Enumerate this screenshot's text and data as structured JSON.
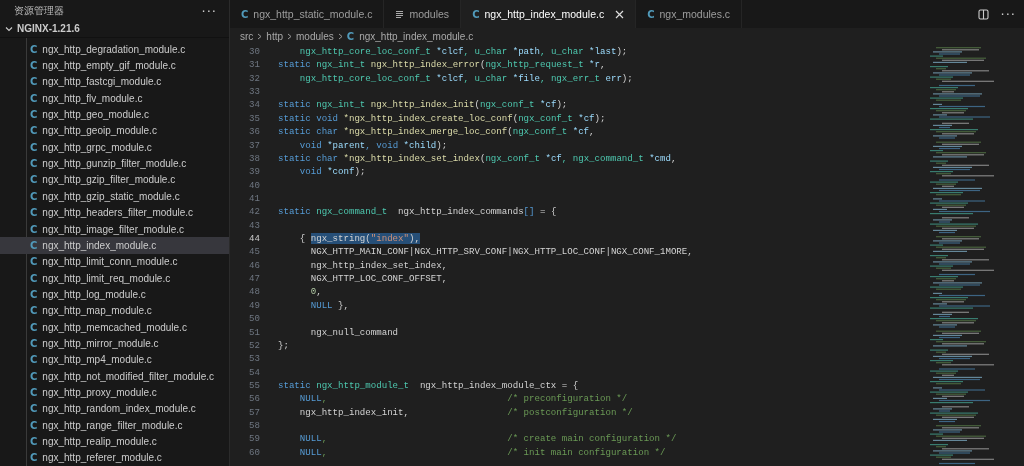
{
  "explorer": {
    "title": "资源管理器",
    "more": "···",
    "folder": {
      "name": "NGINX-1.21.6",
      "expanded": true,
      "children": [
        {
          "name": "ngx_http_degradation_module.c",
          "icon": "C",
          "selected": false
        },
        {
          "name": "ngx_http_empty_gif_module.c",
          "icon": "C",
          "selected": false
        },
        {
          "name": "ngx_http_fastcgi_module.c",
          "icon": "C",
          "selected": false
        },
        {
          "name": "ngx_http_flv_module.c",
          "icon": "C",
          "selected": false
        },
        {
          "name": "ngx_http_geo_module.c",
          "icon": "C",
          "selected": false
        },
        {
          "name": "ngx_http_geoip_module.c",
          "icon": "C",
          "selected": false
        },
        {
          "name": "ngx_http_grpc_module.c",
          "icon": "C",
          "selected": false
        },
        {
          "name": "ngx_http_gunzip_filter_module.c",
          "icon": "C",
          "selected": false
        },
        {
          "name": "ngx_http_gzip_filter_module.c",
          "icon": "C",
          "selected": false
        },
        {
          "name": "ngx_http_gzip_static_module.c",
          "icon": "C",
          "selected": false
        },
        {
          "name": "ngx_http_headers_filter_module.c",
          "icon": "C",
          "selected": false
        },
        {
          "name": "ngx_http_image_filter_module.c",
          "icon": "C",
          "selected": false
        },
        {
          "name": "ngx_http_index_module.c",
          "icon": "C",
          "selected": true
        },
        {
          "name": "ngx_http_limit_conn_module.c",
          "icon": "C",
          "selected": false
        },
        {
          "name": "ngx_http_limit_req_module.c",
          "icon": "C",
          "selected": false
        },
        {
          "name": "ngx_http_log_module.c",
          "icon": "C",
          "selected": false
        },
        {
          "name": "ngx_http_map_module.c",
          "icon": "C",
          "selected": false
        },
        {
          "name": "ngx_http_memcached_module.c",
          "icon": "C",
          "selected": false
        },
        {
          "name": "ngx_http_mirror_module.c",
          "icon": "C",
          "selected": false
        },
        {
          "name": "ngx_http_mp4_module.c",
          "icon": "C",
          "selected": false
        },
        {
          "name": "ngx_http_not_modified_filter_module.c",
          "icon": "C",
          "selected": false
        },
        {
          "name": "ngx_http_proxy_module.c",
          "icon": "C",
          "selected": false
        },
        {
          "name": "ngx_http_random_index_module.c",
          "icon": "C",
          "selected": false
        },
        {
          "name": "ngx_http_range_filter_module.c",
          "icon": "C",
          "selected": false
        },
        {
          "name": "ngx_http_realip_module.c",
          "icon": "C",
          "selected": false
        },
        {
          "name": "ngx_http_referer_module.c",
          "icon": "C",
          "selected": false
        }
      ]
    }
  },
  "tabs": [
    {
      "label": "ngx_http_static_module.c",
      "kind": "c",
      "icon": "C",
      "selected": false
    },
    {
      "label": "modules",
      "kind": "text",
      "selected": false
    },
    {
      "label": "ngx_http_index_module.c",
      "kind": "c",
      "icon": "C",
      "selected": true
    },
    {
      "label": "ngx_modules.c",
      "kind": "c",
      "icon": "C",
      "selected": false
    }
  ],
  "editor_actions": {
    "more": "···"
  },
  "breadcrumb": [
    {
      "label": "src",
      "kind": "folder"
    },
    {
      "label": "http",
      "kind": "folder"
    },
    {
      "label": "modules",
      "kind": "folder"
    },
    {
      "label": "ngx_http_index_module.c",
      "kind": "c",
      "icon": "C"
    }
  ],
  "code": [
    {
      "n": "30",
      "current": false,
      "tokens": [
        {
          "kind": "type",
          "text": "    ngx_http_core_loc_conf_t"
        },
        {
          "kind": "var",
          "text": " *clcf"
        },
        {
          "kind": "type",
          "text": ", u_char"
        },
        {
          "kind": "var",
          "text": " *path"
        },
        {
          "kind": "type",
          "text": ", u_char"
        },
        {
          "kind": "var",
          "text": " *last"
        },
        {
          "kind": "plain",
          "text": ");"
        }
      ]
    },
    {
      "n": "31",
      "current": false,
      "tokens": [
        {
          "kind": "keyword",
          "text": "static"
        },
        {
          "kind": "type",
          "text": " ngx_int_t"
        },
        {
          "kind": "function",
          "text": " ngx_http_index_error"
        },
        {
          "kind": "plain",
          "text": "("
        },
        {
          "kind": "type",
          "text": "ngx_http_request_t"
        },
        {
          "kind": "var",
          "text": " *r"
        },
        {
          "kind": "plain",
          "text": ","
        }
      ]
    },
    {
      "n": "32",
      "current": false,
      "tokens": [
        {
          "kind": "type",
          "text": "    ngx_http_core_loc_conf_t"
        },
        {
          "kind": "var",
          "text": " *clcf"
        },
        {
          "kind": "type",
          "text": ", u_char"
        },
        {
          "kind": "var",
          "text": " *file"
        },
        {
          "kind": "type",
          "text": ", ngx_err_t"
        },
        {
          "kind": "var",
          "text": " err"
        },
        {
          "kind": "plain",
          "text": ");"
        }
      ]
    },
    {
      "n": "33",
      "current": false
    },
    {
      "n": "34",
      "current": false,
      "tokens": [
        {
          "kind": "keyword",
          "text": "static"
        },
        {
          "kind": "type",
          "text": " ngx_int_t"
        },
        {
          "kind": "function",
          "text": " ngx_http_index_init"
        },
        {
          "kind": "plain",
          "text": "("
        },
        {
          "kind": "type",
          "text": "ngx_conf_t"
        },
        {
          "kind": "var",
          "text": " *cf"
        },
        {
          "kind": "plain",
          "text": ");"
        }
      ]
    },
    {
      "n": "35",
      "current": false,
      "tokens": [
        {
          "kind": "keyword",
          "text": "static void"
        },
        {
          "kind": "function",
          "text": " *ngx_http_index_create_loc_conf"
        },
        {
          "kind": "plain",
          "text": "("
        },
        {
          "kind": "type",
          "text": "ngx_conf_t"
        },
        {
          "kind": "var",
          "text": " *cf"
        },
        {
          "kind": "plain",
          "text": ");"
        }
      ]
    },
    {
      "n": "36",
      "current": false,
      "tokens": [
        {
          "kind": "keyword",
          "text": "static char"
        },
        {
          "kind": "function",
          "text": " *ngx_http_index_merge_loc_conf"
        },
        {
          "kind": "plain",
          "text": "("
        },
        {
          "kind": "type",
          "text": "ngx_conf_t"
        },
        {
          "kind": "var",
          "text": " *cf"
        },
        {
          "kind": "plain",
          "text": ","
        }
      ]
    },
    {
      "n": "37",
      "current": false,
      "tokens": [
        {
          "kind": "keyword",
          "text": "    void"
        },
        {
          "kind": "var",
          "text": " *parent"
        },
        {
          "kind": "keyword",
          "text": ", void"
        },
        {
          "kind": "var",
          "text": " *child"
        },
        {
          "kind": "plain",
          "text": ");"
        }
      ]
    },
    {
      "n": "38",
      "current": false,
      "tokens": [
        {
          "kind": "keyword",
          "text": "static char"
        },
        {
          "kind": "function",
          "text": " *ngx_http_index_set_index"
        },
        {
          "kind": "plain",
          "text": "("
        },
        {
          "kind": "type",
          "text": "ngx_conf_t"
        },
        {
          "kind": "var",
          "text": " *cf"
        },
        {
          "kind": "type",
          "text": ", ngx_command_t"
        },
        {
          "kind": "var",
          "text": " *cmd"
        },
        {
          "kind": "plain",
          "text": ","
        }
      ]
    },
    {
      "n": "39",
      "current": false,
      "tokens": [
        {
          "kind": "keyword",
          "text": "    void"
        },
        {
          "kind": "var",
          "text": " *conf"
        },
        {
          "kind": "plain",
          "text": ");"
        }
      ]
    },
    {
      "n": "40",
      "current": false
    },
    {
      "n": "41",
      "current": false
    },
    {
      "n": "42",
      "current": false,
      "tokens": [
        {
          "kind": "keyword",
          "text": "static"
        },
        {
          "kind": "type",
          "text": " ngx_command_t"
        },
        {
          "kind": "plain",
          "text": "  ngx_http_index_commands"
        },
        {
          "kind": "keyword",
          "text": "[]"
        },
        {
          "kind": "plain",
          "text": " = {"
        }
      ]
    },
    {
      "n": "43",
      "current": false
    },
    {
      "n": "44",
      "current": true,
      "tokens": [
        {
          "kind": "plain",
          "text": "    { "
        },
        {
          "kind": "plain",
          "text": "ngx_string(",
          "highlighted": true
        },
        {
          "kind": "string",
          "text": "\"index\"",
          "highlighted": true
        },
        {
          "kind": "plain",
          "text": "),",
          "highlighted": true
        }
      ]
    },
    {
      "n": "45",
      "current": false,
      "tokens": [
        {
          "kind": "plain",
          "text": "      NGX_HTTP_MAIN_CONF|NGX_HTTP_SRV_CONF|NGX_HTTP_LOC_CONF|NGX_CONF_1MORE,"
        }
      ]
    },
    {
      "n": "46",
      "current": false,
      "tokens": [
        {
          "kind": "plain",
          "text": "      ngx_http_index_set_index,"
        }
      ]
    },
    {
      "n": "47",
      "current": false,
      "tokens": [
        {
          "kind": "plain",
          "text": "      NGX_HTTP_LOC_CONF_OFFSET,"
        }
      ]
    },
    {
      "n": "48",
      "current": false,
      "tokens": [
        {
          "kind": "number",
          "text": "      0"
        },
        {
          "kind": "plain",
          "text": ","
        }
      ]
    },
    {
      "n": "49",
      "current": false,
      "tokens": [
        {
          "kind": "keyword",
          "text": "      NULL"
        },
        {
          "kind": "plain",
          "text": " },"
        }
      ]
    },
    {
      "n": "50",
      "current": false
    },
    {
      "n": "51",
      "current": false,
      "tokens": [
        {
          "kind": "plain",
          "text": "      ngx_null_command"
        }
      ]
    },
    {
      "n": "52",
      "current": false,
      "tokens": [
        {
          "kind": "plain",
          "text": "};"
        }
      ]
    },
    {
      "n": "53",
      "current": false
    },
    {
      "n": "54",
      "current": false
    },
    {
      "n": "55",
      "current": false,
      "tokens": [
        {
          "kind": "keyword",
          "text": "static"
        },
        {
          "kind": "type",
          "text": " ngx_http_module_t"
        },
        {
          "kind": "plain",
          "text": "  ngx_http_index_module_ctx = {"
        }
      ]
    },
    {
      "n": "56",
      "current": false,
      "tokens": [
        {
          "kind": "keyword",
          "text": "    NULL"
        },
        {
          "kind": "comment",
          "text": ",                                 /* preconfiguration */"
        }
      ]
    },
    {
      "n": "57",
      "current": false,
      "tokens": [
        {
          "kind": "plain",
          "text": "    ngx_http_index_init,"
        },
        {
          "kind": "comment",
          "text": "                  /* postconfiguration */"
        }
      ]
    },
    {
      "n": "58",
      "current": false
    },
    {
      "n": "59",
      "current": false,
      "tokens": [
        {
          "kind": "keyword",
          "text": "    NULL"
        },
        {
          "kind": "comment",
          "text": ",                                 /* create main configuration */"
        }
      ]
    },
    {
      "n": "60",
      "current": false,
      "tokens": [
        {
          "kind": "keyword",
          "text": "    NULL"
        },
        {
          "kind": "comment",
          "text": ",                                 /* init main configuration */"
        }
      ]
    }
  ]
}
